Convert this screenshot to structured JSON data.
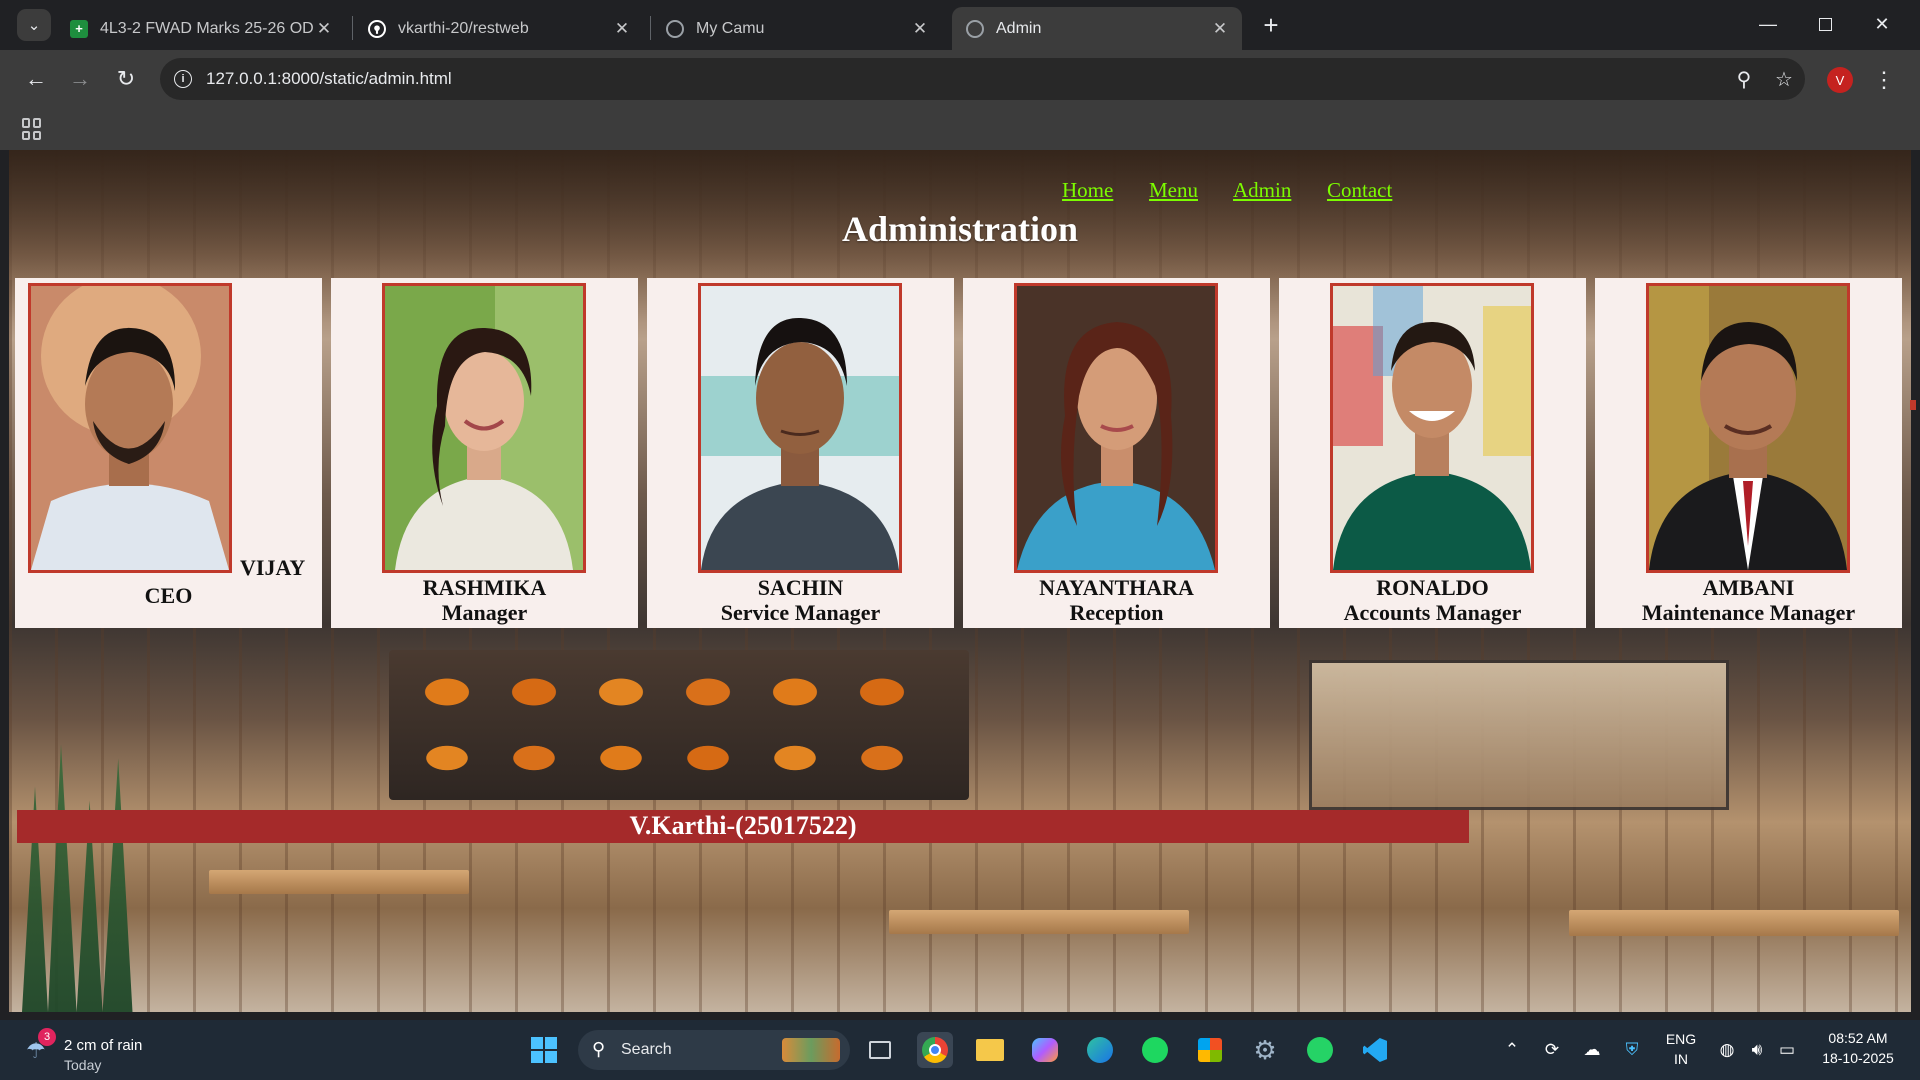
{
  "browser": {
    "tabs": [
      {
        "title": "4L3-2 FWAD Marks 25-26 ODD",
        "icon": "sheets-icon",
        "active": false
      },
      {
        "title": "vkarthi-20/restweb",
        "icon": "github-icon",
        "active": false
      },
      {
        "title": "My Camu",
        "icon": "globe-icon",
        "active": false
      },
      {
        "title": "Admin",
        "icon": "globe-icon",
        "active": true
      }
    ],
    "url": "127.0.0.1:8000/static/admin.html",
    "profile_initial": "V"
  },
  "page": {
    "nav": {
      "home": "Home",
      "menu": "Menu",
      "admin": "Admin",
      "contact": "Contact"
    },
    "title": "Administration",
    "staff": [
      {
        "name": "VIJAY",
        "role": "CEO"
      },
      {
        "name": "RASHMIKA",
        "role": "Manager"
      },
      {
        "name": "SACHIN",
        "role": "Service Manager"
      },
      {
        "name": "NAYANTHARA",
        "role": "Reception"
      },
      {
        "name": "RONALDO",
        "role": "Accounts Manager"
      },
      {
        "name": "AMBANI",
        "role": "Maintenance Manager"
      }
    ],
    "footer": "V.Karthi-(25017522)"
  },
  "taskbar": {
    "weather": {
      "text": "2 cm of rain",
      "day": "Today",
      "badge": "3"
    },
    "search_label": "Search",
    "lang": "ENG",
    "region": "IN",
    "time": "08:52 AM",
    "date": "18-10-2025"
  },
  "colors": {
    "nav_link": "#7cfc00",
    "photo_border": "#c0392b",
    "footer_bar": "#a52a2a",
    "card_bg": "#f8efed"
  }
}
